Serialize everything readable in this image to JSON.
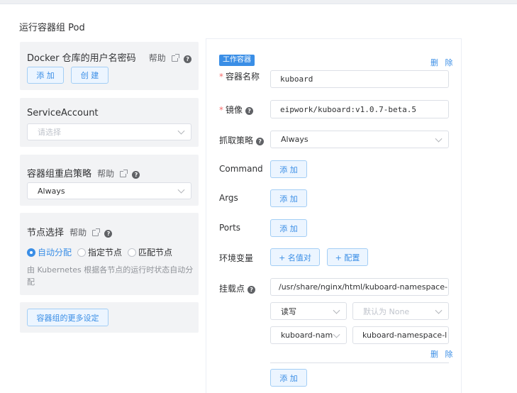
{
  "section_title": "运行容器组 Pod",
  "docker": {
    "title": "Docker 仓库的用户名密码",
    "help": "帮助",
    "add_label": "添 加",
    "create_label": "创 建"
  },
  "service_account": {
    "title": "ServiceAccount",
    "placeholder": "请选择"
  },
  "restart_policy": {
    "title": "容器组重启策略",
    "help": "帮助",
    "value": "Always"
  },
  "node_selection": {
    "title": "节点选择",
    "help": "帮助",
    "options": [
      "自动分配",
      "指定节点",
      "匹配节点"
    ],
    "selected": "自动分配",
    "description": "由 Kubernetes 根据各节点的运行时状态自动分配"
  },
  "more_settings_label": "容器组的更多设定",
  "container": {
    "tag": "工作容器",
    "delete_label": "删 除",
    "name_label": "容器名称",
    "name_value": "kuboard",
    "image_label": "镜像",
    "image_value": "eipwork/kuboard:v1.0.7-beta.5",
    "pull_policy_label": "抓取策略",
    "pull_policy_value": "Always",
    "command_label": "Command",
    "args_label": "Args",
    "ports_label": "Ports",
    "add_label": "添 加",
    "env_label": "环境变量",
    "env_add_name_value": "+ 名值对",
    "env_add_config": "+ 配置",
    "mount_label": "挂载点",
    "mount_path": "/usr/share/nginx/html/kuboard-namespace-lay",
    "mount_mode": "读写",
    "mount_default_placeholder": "默认为 None",
    "mount_volume": "kuboard-nam",
    "mount_subpath": "kuboard-namespace-l",
    "mount_delete_label": "删 除",
    "mount_add_label": "添 加"
  }
}
